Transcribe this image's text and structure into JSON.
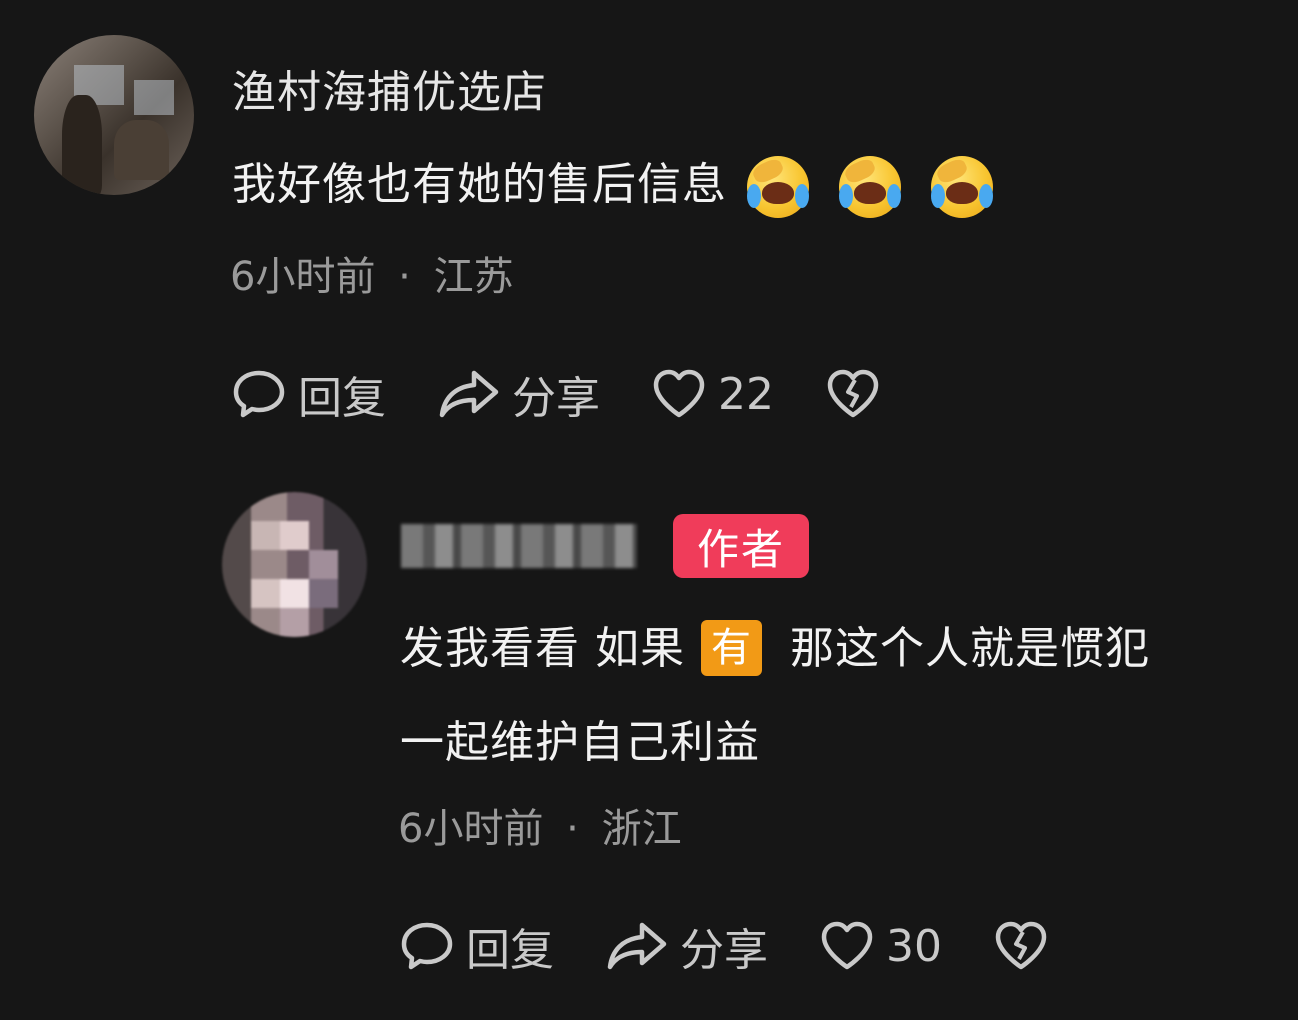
{
  "comment": {
    "username": "渔村海捕优选店",
    "text": "我好像也有她的售后信息",
    "emojis": [
      "crying-laughing-emoji",
      "crying-laughing-emoji",
      "crying-laughing-emoji"
    ],
    "time": "6小时前",
    "separator": "·",
    "location": "江苏",
    "actions": {
      "reply": "回复",
      "share": "分享",
      "likes": "22"
    }
  },
  "reply": {
    "badge": "作者",
    "text_part1": "发我看看 如果",
    "highlight_tag": "有",
    "text_part2": "那这个人就是惯犯",
    "text_line2": "一起维护自己利益",
    "time": "6小时前",
    "separator": "·",
    "location": "浙江",
    "actions": {
      "reply": "回复",
      "share": "分享",
      "likes": "30"
    }
  },
  "colors": {
    "background": "#161616",
    "author_badge": "#f03c5a",
    "highlight_tag": "#f29a16",
    "meta_text": "#9a9a9a"
  }
}
